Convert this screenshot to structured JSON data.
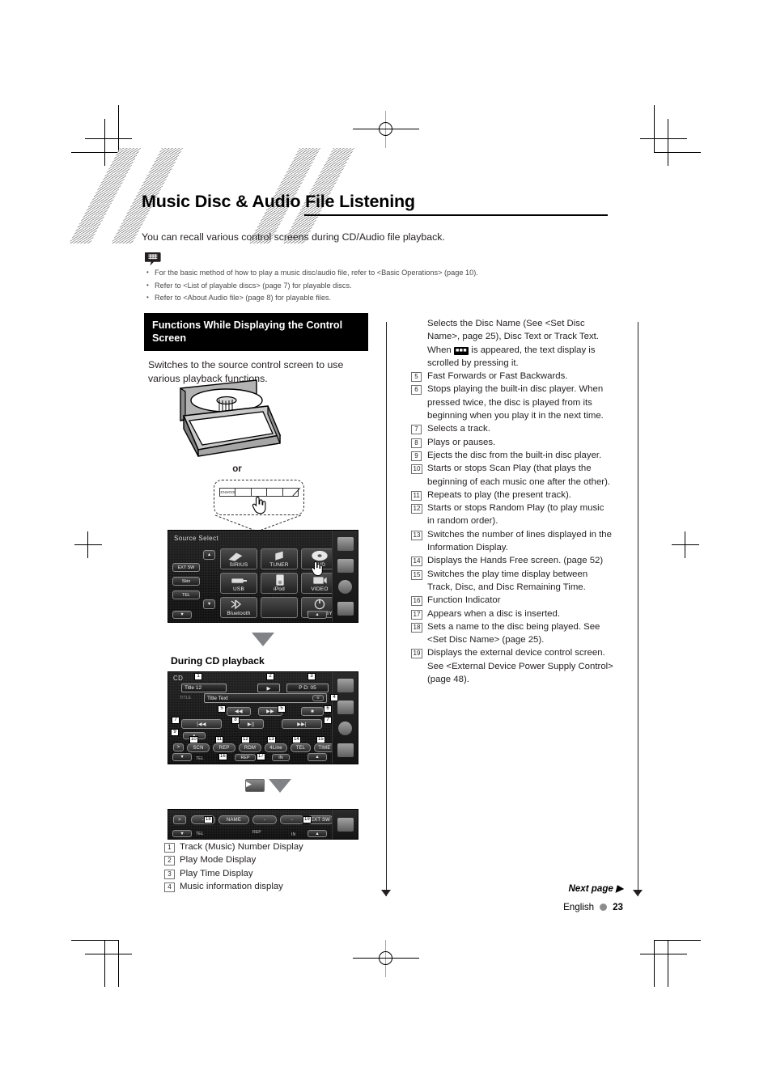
{
  "page": {
    "title": "Music Disc & Audio File Listening",
    "intro": "You can recall various control screens during CD/Audio file playback.",
    "notes": [
      "For the basic method of how to play a music disc/audio file, refer to <Basic Operations> (page 10).",
      "Refer to <List of playable discs> (page 7) for playable discs.",
      "Refer to <About Audio file> (page 8) for playable files."
    ],
    "note_icon": "note-bubble-icon"
  },
  "left": {
    "section_heading": "Functions While Displaying the Control Screen",
    "section_body": "Switches to the source control screen to use various playback functions.",
    "or_label": "or",
    "subheading": "During CD playback",
    "legend": [
      {
        "num": "1",
        "text": "Track (Music) Number Display"
      },
      {
        "num": "2",
        "text": "Play Mode Display"
      },
      {
        "num": "3",
        "text": "Play Time Display"
      },
      {
        "num": "4",
        "text": "Music information display"
      }
    ]
  },
  "right": {
    "lead_text_1": "Selects the Disc Name (See <Set Disc Name>, page 25), Disc Text or Track Text. When",
    "lead_glyph": "scroll-icon",
    "lead_text_2": "is appeared, the text display is scrolled by pressing it.",
    "items": [
      {
        "num": "5",
        "text": "Fast Forwards or Fast Backwards."
      },
      {
        "num": "6",
        "text": "Stops playing the built-in disc player. When pressed twice, the disc is played from its beginning when you play it in the next time."
      },
      {
        "num": "7",
        "text": "Selects a track."
      },
      {
        "num": "8",
        "text": "Plays or pauses."
      },
      {
        "num": "9",
        "text": "Ejects the disc from the built-in disc player."
      },
      {
        "num": "10",
        "text": "Starts or stops Scan Play (that plays the beginning of each music one after the other)."
      },
      {
        "num": "11",
        "text": "Repeats to play (the present track)."
      },
      {
        "num": "12",
        "text": "Starts or stops Random Play (to play music in random order)."
      },
      {
        "num": "13",
        "text": "Switches the number of lines displayed in the Information Display."
      },
      {
        "num": "14",
        "text": "Displays the Hands Free screen. (page 52)"
      },
      {
        "num": "15",
        "text": "Switches the play time display between Track, Disc, and Disc Remaining Time."
      },
      {
        "num": "16",
        "text": "Function Indicator"
      },
      {
        "num": "17",
        "text": "Appears when a disc is inserted."
      },
      {
        "num": "18",
        "text": "Sets a name to the disc being played. See <Set Disc Name> (page 25)."
      },
      {
        "num": "19",
        "text": "Displays the external device control screen. See <External Device Power Supply Control> (page 48)."
      }
    ]
  },
  "source_select_screen": {
    "title": "Source Select",
    "left_buttons": [
      "EXT SW",
      "Skin",
      "TEL"
    ],
    "scroll_up": "▲",
    "scroll_down": "▼",
    "sources": [
      "SIRIUS",
      "TUNER",
      "DVD",
      "USB",
      "iPod",
      "VIDEO",
      "Bluetooth",
      "",
      "STANDBY"
    ],
    "cursor": "hand-pointer-icon",
    "bottom_left": "▼",
    "bottom_right": "▲"
  },
  "cd_screen": {
    "source_label": "CD",
    "track_field": "Title 12",
    "play_mode": "▶",
    "time_field": "P   D: 05",
    "info_tag": "TITLE",
    "info_field": "Title Text",
    "scroll_button": "scroll-icon",
    "transport": {
      "fast_backward": "◀◀",
      "fast_forward": "▶▶",
      "stop": "■",
      "track_prev": "|◀◀",
      "play_pause": "▶||",
      "track_next": "▶▶|",
      "eject": "▲"
    },
    "function_buttons": [
      "SCN",
      "REP",
      "RDM",
      "4Line",
      "TEL",
      "TIME"
    ],
    "status_bar": {
      "tel": "TEL",
      "rep": "REP",
      "in": "IN"
    },
    "callouts": [
      "1",
      "2",
      "3",
      "4",
      "5",
      "6",
      "7",
      "8",
      "9",
      "10",
      "11",
      "12",
      "13",
      "14",
      "15",
      "16",
      "17"
    ]
  },
  "ext_screen": {
    "next_button": "▶",
    "blank_label": "-",
    "name_button": "NAME",
    "ext_sw_button": "EXT SW",
    "status_bar": {
      "tel": "TEL",
      "rep": "REP",
      "in": "IN"
    },
    "callouts": [
      "18",
      "19"
    ]
  },
  "footer": {
    "next_page": "Next page ▶",
    "language": "English",
    "page_number": "23"
  },
  "colors": {
    "heading_bg": "#000000",
    "heading_fg": "#ffffff",
    "body": "#231f20",
    "note": "#4a4a4a",
    "arrow": "#808285"
  }
}
